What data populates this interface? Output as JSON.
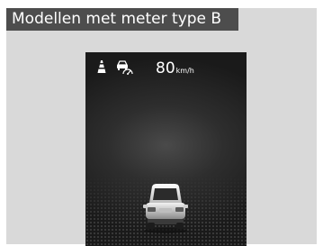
{
  "header": {
    "title": "Modellen met meter type B"
  },
  "display": {
    "icons": {
      "lane_keeping": "lane-keeping-assist-icon",
      "adaptive_cruise": "adaptive-cruise-control-icon",
      "vehicle": "own-vehicle-icon"
    },
    "speed": {
      "value": "80",
      "unit": "km/h"
    }
  },
  "colors": {
    "header_bg": "#4d4d4d",
    "frame_bg": "#d9d9d9",
    "display_bg": "#1a1a1a",
    "text": "#ffffff"
  }
}
